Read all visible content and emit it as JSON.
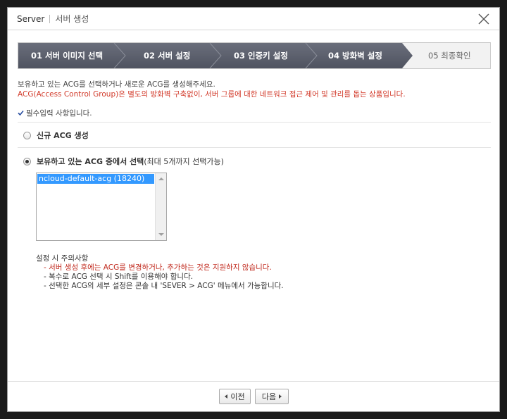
{
  "window": {
    "app": "Server",
    "subtitle": "서버 생성"
  },
  "steps": [
    {
      "label": "01 서버 이미지 선택",
      "state": "done"
    },
    {
      "label": "02 서버 설정",
      "state": "done"
    },
    {
      "label": "03 인증키 설정",
      "state": "done"
    },
    {
      "label": "04 방화벽 설정",
      "state": "current"
    },
    {
      "label": "05 최종확인",
      "state": "pending"
    }
  ],
  "intro": {
    "line1": "보유하고 있는 ACG를 선택하거나 새로운 ACG를 생성해주세요.",
    "line2": "ACG(Access Control Group)은 별도의 방화벽 구축없이, 서버 그룹에 대한 네트워크 접근 제어 및 관리를 돕는 상품입니다."
  },
  "required_note": "필수입력 사항입니다.",
  "options": {
    "new_acg": {
      "label": "신규 ACG 생성",
      "checked": false
    },
    "existing_acg": {
      "label": "보유하고 있는 ACG 중에서 선택",
      "hint": "(최대 5개까지 선택가능)",
      "checked": true
    }
  },
  "acg_list": {
    "items": [
      "ncloud-default-acg (18240)"
    ],
    "selected": 0
  },
  "notes": {
    "title": "설정 시 주의사항",
    "items": [
      {
        "text": "- 서버 생성 후에는 ACG를 변경하거나, 추가하는 것은 지원하지 않습니다.",
        "highlight": true
      },
      {
        "text": "- 복수로 ACG 선택 시 Shift를 이용해야 합니다.",
        "highlight": false
      },
      {
        "text": "- 선택한 ACG의 세부 설정은 콘솔 내 'SEVER > ACG' 메뉴에서 가능합니다.",
        "highlight": false
      }
    ]
  },
  "buttons": {
    "prev": "이전",
    "next": "다음"
  },
  "colors": {
    "step_dark": "#5b5f6c",
    "step_pending": "#f2f2f2",
    "accent_red": "#d23a2a",
    "selection_blue": "#3399ff"
  }
}
